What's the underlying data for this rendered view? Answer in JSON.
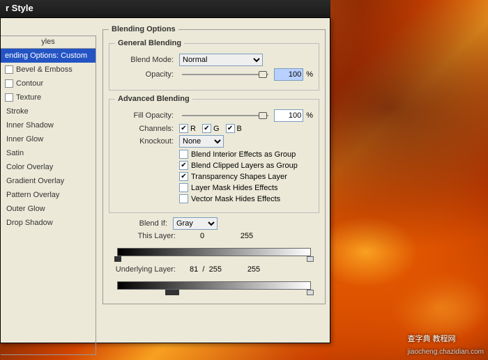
{
  "titlebar": "r Style",
  "styles": {
    "header": "yles",
    "items": [
      {
        "label": "ending Options: Custom",
        "checked": false,
        "selected": true
      },
      {
        "label": "Bevel & Emboss",
        "checked": false
      },
      {
        "label": "Contour",
        "checked": false,
        "indent": true
      },
      {
        "label": "Texture",
        "checked": false,
        "indent": true
      },
      {
        "label": "Stroke",
        "checked": false,
        "nocb": true
      },
      {
        "label": "Inner Shadow",
        "checked": false,
        "nocb": true
      },
      {
        "label": "Inner Glow",
        "checked": false,
        "nocb": true
      },
      {
        "label": "Satin",
        "checked": false,
        "nocb": true
      },
      {
        "label": "Color Overlay",
        "checked": false,
        "nocb": true
      },
      {
        "label": "Gradient Overlay",
        "checked": false,
        "nocb": true
      },
      {
        "label": "Pattern Overlay",
        "checked": false,
        "nocb": true
      },
      {
        "label": "Outer Glow",
        "checked": false,
        "nocb": true
      },
      {
        "label": "Drop Shadow",
        "checked": false,
        "nocb": true
      }
    ]
  },
  "blending": {
    "title": "Blending Options",
    "general": {
      "title": "General Blending",
      "mode_label": "Blend Mode:",
      "mode_value": "Normal",
      "opacity_label": "Opacity:",
      "opacity_value": "100",
      "opacity_unit": "%"
    },
    "advanced": {
      "title": "Advanced Blending",
      "fill_label": "Fill Opacity:",
      "fill_value": "100",
      "fill_unit": "%",
      "channels_label": "Channels:",
      "channels": {
        "R": "R",
        "G": "G",
        "B": "B",
        "r_on": true,
        "g_on": true,
        "b_on": true
      },
      "knockout_label": "Knockout:",
      "knockout_value": "None",
      "opts": {
        "interior": {
          "label": "Blend Interior Effects as Group",
          "on": false
        },
        "clipped": {
          "label": "Blend Clipped Layers as Group",
          "on": true
        },
        "trans": {
          "label": "Transparency Shapes Layer",
          "on": true
        },
        "layermask": {
          "label": "Layer Mask Hides Effects",
          "on": false
        },
        "vectormask": {
          "label": "Vector Mask Hides Effects",
          "on": false
        }
      }
    },
    "blendif": {
      "label": "Blend If:",
      "value": "Gray",
      "thislayer": {
        "label": "This Layer:",
        "low": "0",
        "high": "255"
      },
      "underlying": {
        "label": "Underlying Layer:",
        "low": "81",
        "sep": "/",
        "low2": "255",
        "high": "255"
      }
    }
  },
  "watermark": {
    "main": "查字典 教程网",
    "sub": "jiaocheng.chazidian.com"
  }
}
